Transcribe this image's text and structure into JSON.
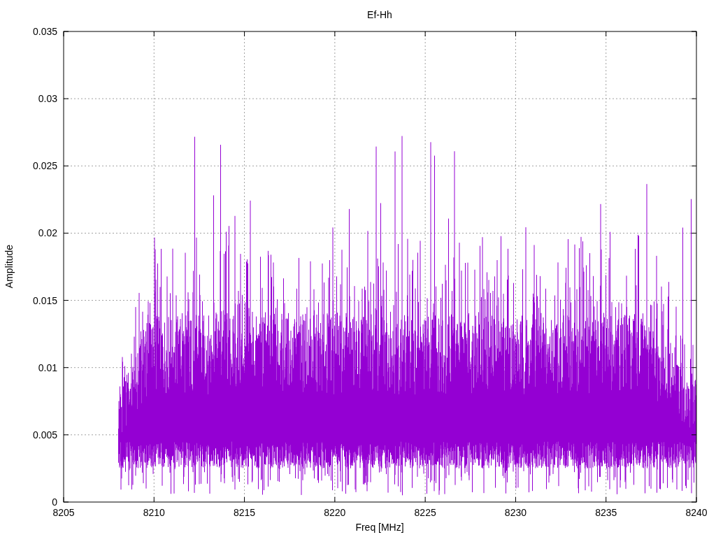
{
  "chart": {
    "title": "Ef-Hh",
    "xlabel": "Freq [MHz]",
    "ylabel": "Amplitude",
    "xticks": [
      "8205",
      "8210",
      "8215",
      "8220",
      "8225",
      "8230",
      "8235",
      "8240"
    ],
    "yticks": [
      "0.035",
      "0.03",
      "0.025",
      "0.02",
      "0.015",
      "0.01",
      "0.005",
      "0"
    ]
  }
}
